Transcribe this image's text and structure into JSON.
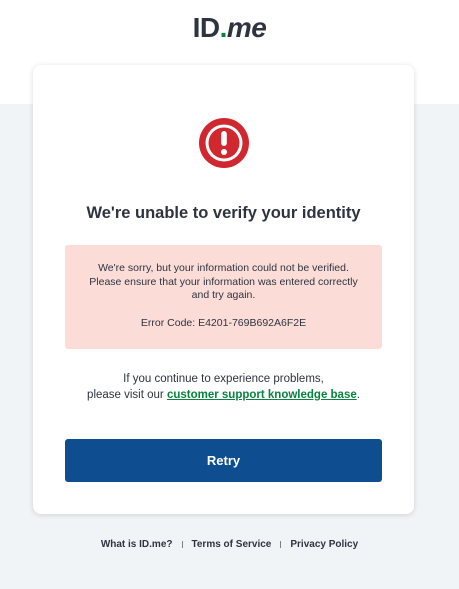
{
  "logo": {
    "id": "ID",
    "dot": ".",
    "me": "me"
  },
  "alert": {
    "icon": "exclamation-circle-icon",
    "color": "#d0282e",
    "title": "We're unable to verify your identity"
  },
  "error_box": {
    "message": "We're sorry, but your information could not be verified. Please ensure that your information was entered correctly and try again.",
    "code_line": "Error Code: E4201-769B692A6F2E",
    "background": "#fcdcd7"
  },
  "help": {
    "line1": "If you continue to experience problems,",
    "prefix": "please visit our ",
    "link_text": "customer support knowledge base",
    "suffix": ".",
    "link_color": "#08833d"
  },
  "retry_button": {
    "label": "Retry",
    "color": "#0e4d8f"
  },
  "footer": {
    "links": [
      "What is ID.me?",
      "Terms of Service",
      "Privacy Policy"
    ]
  }
}
